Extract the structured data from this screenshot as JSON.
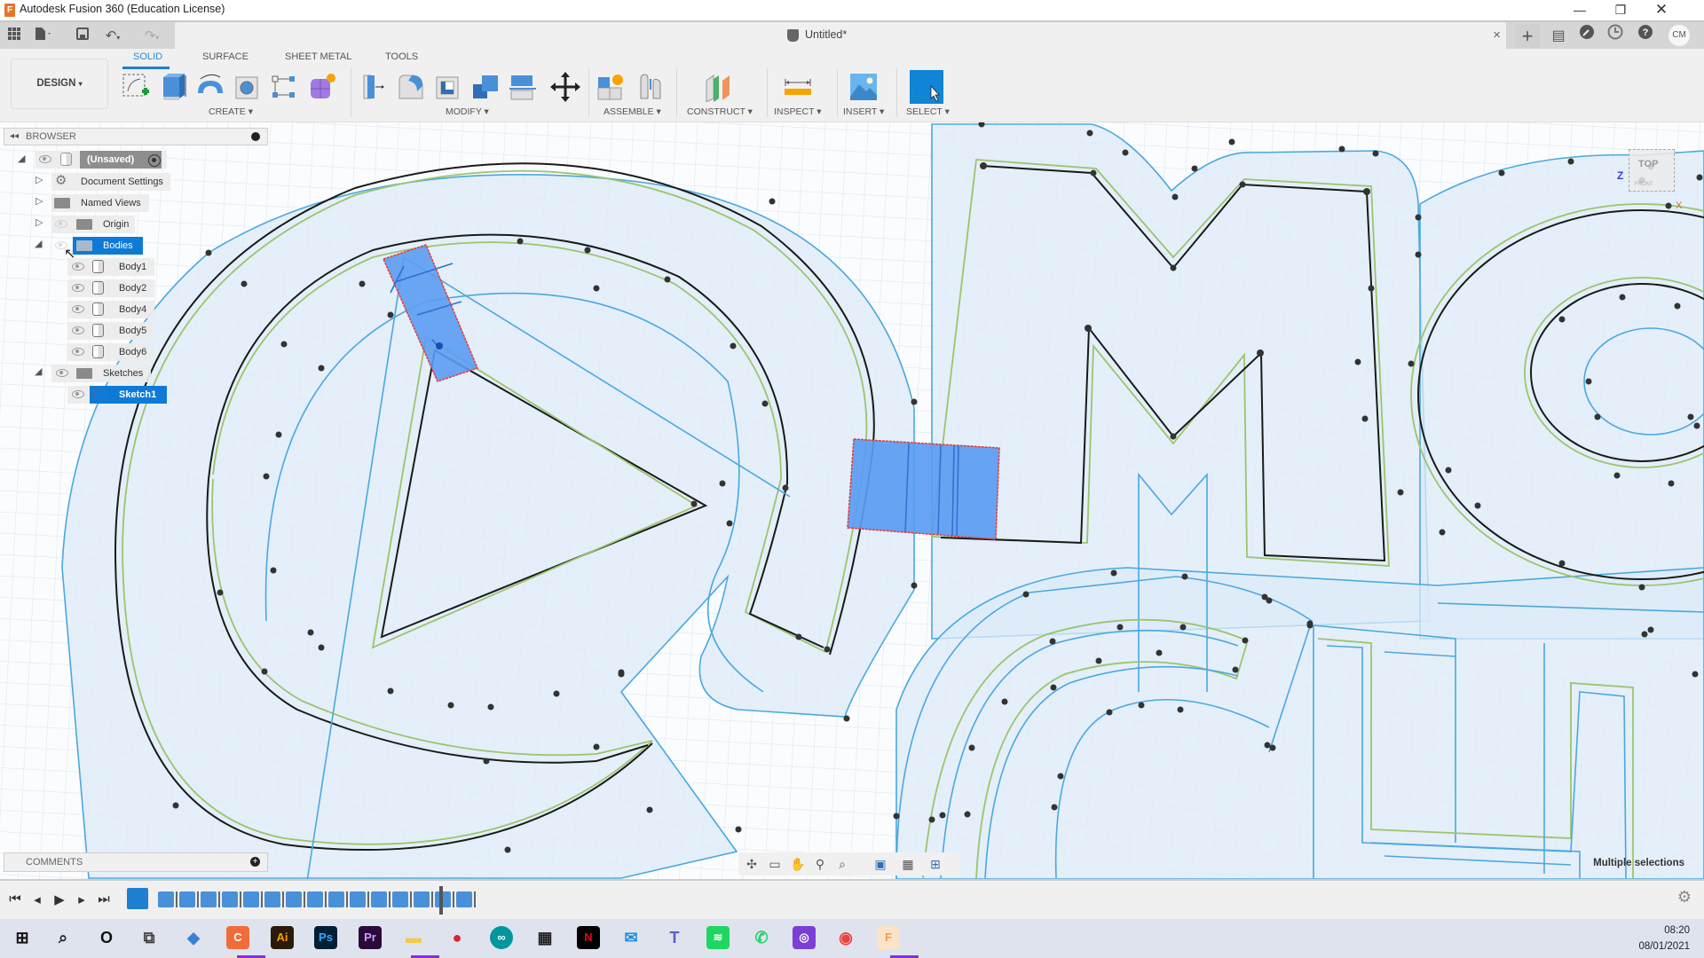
{
  "window": {
    "title": "Autodesk Fusion 360 (Education License)",
    "controls": [
      "minimize",
      "restore",
      "close"
    ]
  },
  "quick_access": {
    "icons": [
      "apps-grid-icon",
      "file-icon",
      "save-icon",
      "undo-icon",
      "redo-icon"
    ]
  },
  "document": {
    "tab_title": "Untitled*",
    "close_label": "×"
  },
  "top_right": {
    "icons": [
      "new-tab-icon",
      "comments-icon",
      "extensions-icon",
      "history-icon",
      "help-icon"
    ],
    "user_initials": "CM"
  },
  "ribbon": {
    "workspace_label": "DESIGN",
    "tabs": [
      {
        "label": "SOLID",
        "active": true
      },
      {
        "label": "SURFACE",
        "active": false
      },
      {
        "label": "SHEET METAL",
        "active": false
      },
      {
        "label": "TOOLS",
        "active": false
      }
    ],
    "groups": [
      {
        "label": "CREATE ▾",
        "tools": [
          "create-sketch",
          "extrude",
          "revolve",
          "hole",
          "pattern",
          "form"
        ]
      },
      {
        "label": "MODIFY ▾",
        "tools": [
          "press-pull",
          "fillet",
          "shell",
          "combine",
          "split-face",
          "move"
        ]
      },
      {
        "label": "ASSEMBLE ▾",
        "tools": [
          "new-component",
          "joint"
        ]
      },
      {
        "label": "CONSTRUCT ▾",
        "tools": [
          "offset-plane"
        ]
      },
      {
        "label": "INSPECT ▾",
        "tools": [
          "measure"
        ]
      },
      {
        "label": "INSERT ▾",
        "tools": [
          "insert-image"
        ]
      },
      {
        "label": "SELECT ▾",
        "tools": [
          "select"
        ]
      }
    ]
  },
  "browser": {
    "header": "BROWSER",
    "root": "(Unsaved)",
    "items": [
      {
        "label": "Document Settings",
        "type": "settings",
        "expanded": false
      },
      {
        "label": "Named Views",
        "type": "folder",
        "expanded": false
      },
      {
        "label": "Origin",
        "type": "folder",
        "expanded": false
      },
      {
        "label": "Bodies",
        "type": "folder",
        "expanded": true,
        "selected": true
      }
    ],
    "bodies": [
      "Body1",
      "Body2",
      "Body4",
      "Body5",
      "Body6"
    ],
    "sketches_label": "Sketches",
    "sketches": [
      {
        "label": "Sketch1",
        "selected": true
      }
    ]
  },
  "viewcube": {
    "face": "TOP",
    "face2": "FRONT",
    "axis_z": "Z",
    "axis_x": "X"
  },
  "comments": {
    "header": "COMMENTS"
  },
  "nav_toolbar": {
    "icons": [
      "orbit-icon",
      "look-at-icon",
      "pan-icon",
      "zoom-icon",
      "fit-icon",
      "display-settings-icon",
      "grid-icon",
      "viewports-icon"
    ]
  },
  "status": {
    "selection": "Multiple selections"
  },
  "timeline": {
    "controls": [
      "first",
      "previous",
      "play",
      "next",
      "last"
    ],
    "steps": 15
  },
  "taskbar": {
    "apps": [
      {
        "name": "start",
        "label": "⊞",
        "color": "#111111"
      },
      {
        "name": "search",
        "label": "⌕",
        "color": "#222222"
      },
      {
        "name": "cortana",
        "label": "O",
        "color": "#111111"
      },
      {
        "name": "task-view",
        "label": "⧉",
        "color": "#444444"
      },
      {
        "name": "app-3d",
        "label": "◆",
        "color": "#3b7fd4"
      },
      {
        "name": "camtasia",
        "label": "C",
        "color": "#f06d3b"
      },
      {
        "name": "illustrator",
        "label": "Ai",
        "color": "#ff9a00"
      },
      {
        "name": "photoshop",
        "label": "Ps",
        "color": "#31a8ff"
      },
      {
        "name": "premiere",
        "label": "Pr",
        "color": "#d39bff"
      },
      {
        "name": "file-explorer",
        "label": "▬",
        "color": "#f7c948"
      },
      {
        "name": "app-red",
        "label": "●",
        "color": "#d62828"
      },
      {
        "name": "arduino",
        "label": "∞",
        "color": "#00979c"
      },
      {
        "name": "store",
        "label": "▦",
        "color": "#222222"
      },
      {
        "name": "netflix",
        "label": "N",
        "color": "#e50914"
      },
      {
        "name": "mail",
        "label": "✉",
        "color": "#1a8ce0"
      },
      {
        "name": "teams",
        "label": "T",
        "color": "#5b5fc7"
      },
      {
        "name": "spotify",
        "label": "≋",
        "color": "#1ed760"
      },
      {
        "name": "whatsapp",
        "label": "✆",
        "color": "#25d366"
      },
      {
        "name": "instagram",
        "label": "◎",
        "color": "#7a3fd6"
      },
      {
        "name": "chrome",
        "label": "◉",
        "color": "#e8453c"
      },
      {
        "name": "fusion360",
        "label": "F",
        "color": "#f39c45"
      }
    ],
    "time": "08:20",
    "date": "08/01/2021"
  },
  "colors": {
    "accent": "#0f7ad6",
    "sketch_black": "#1a1a1a",
    "sketch_blue": "#4aa8dd",
    "offset_green": "#9cc46c",
    "profile_fill": "#d6e9f7",
    "selection_fill": "#5b9cf2",
    "selection_edge": "#e53935"
  }
}
